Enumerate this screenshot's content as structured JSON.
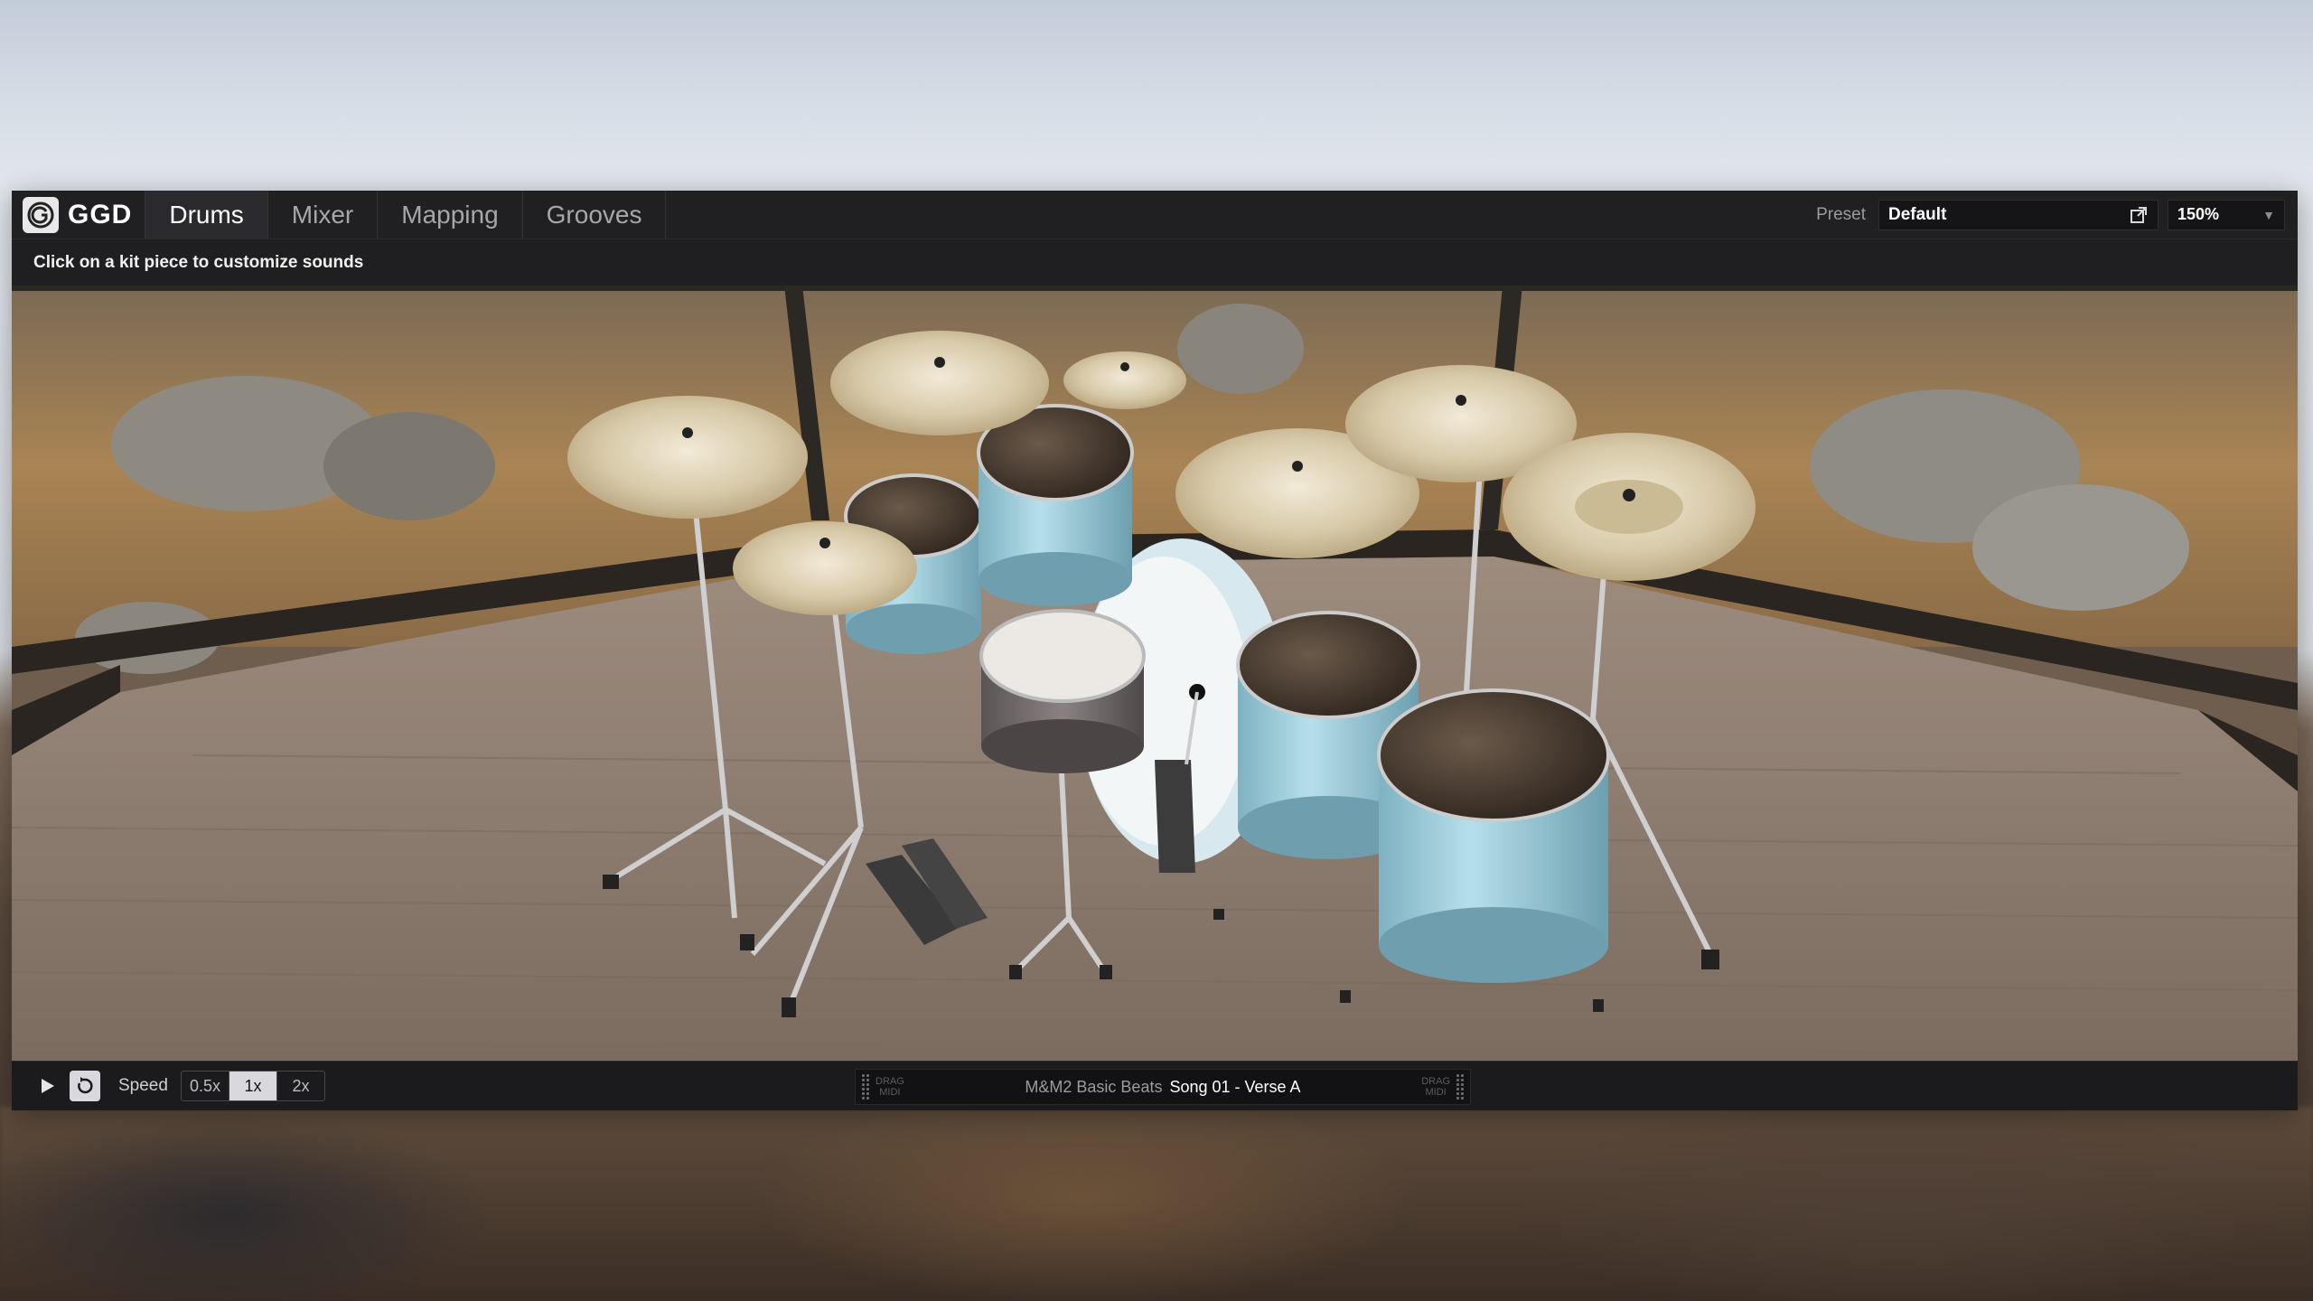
{
  "app": {
    "logo_text": "GGD",
    "tabs": [
      {
        "label": "Drums",
        "active": true
      },
      {
        "label": "Mixer",
        "active": false
      },
      {
        "label": "Mapping",
        "active": false
      },
      {
        "label": "Grooves",
        "active": false
      }
    ],
    "preset": {
      "label": "Preset",
      "value": "Default"
    },
    "zoom": {
      "value": "150%"
    }
  },
  "hint": {
    "text": "Click on a kit piece to customize sounds"
  },
  "transport": {
    "speed_label": "Speed",
    "speed_options": [
      "0.5x",
      "1x",
      "2x"
    ],
    "speed_selected": "1x",
    "drag_label_line1": "DRAG",
    "drag_label_line2": "MIDI",
    "groove_library": "M&M2 Basic Beats",
    "groove_name": "Song 01 - Verse A"
  },
  "colors": {
    "panel_bg": "#1a1a1c",
    "shell_color": "#a6d3e0",
    "cymbal_color": "#d8ccae",
    "floor_color": "#8f7f71"
  },
  "icons": {
    "play": "play-icon",
    "loop": "loop-icon",
    "external": "external-link-icon",
    "chevron": "chevron-down-icon",
    "logo": "ggd-logo-icon"
  }
}
